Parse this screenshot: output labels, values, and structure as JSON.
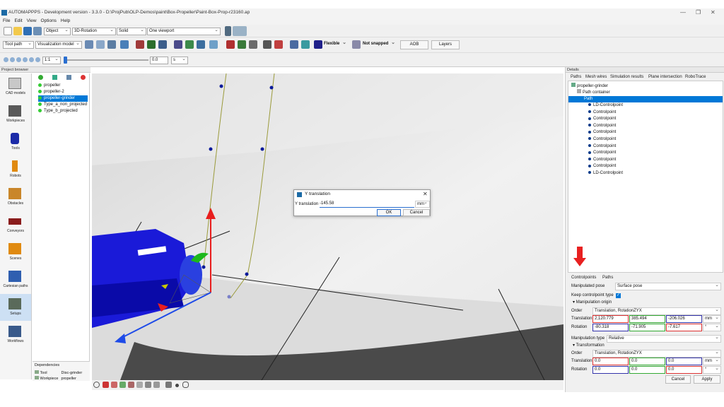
{
  "window": {
    "title": "AUTOMAPPPS - Development version - 3.3.0 - D:\\ProjPub\\OLP-Demos\\paint\\Box-Propeller\\Paint-Box-Prop-r23160.ap"
  },
  "menu": [
    "File",
    "Edit",
    "View",
    "Options",
    "Help"
  ],
  "toolbar": {
    "object_select": "Object",
    "rotation_select": "3D-Rotation",
    "shading_select": "Solid",
    "viewport_select": "One viewport",
    "toolpath_select": "Tool path",
    "visualization_select": "Visualization model",
    "flexible_label": "Flexible",
    "snap_label": "Not snapped",
    "aob_label": "AOB",
    "layers_label": "Layers",
    "speed_select": "1:1",
    "time_value": "0.0",
    "time_unit": "s"
  },
  "project_browser": {
    "title": "Project browser",
    "sidebar": [
      "CAD models",
      "Workpieces",
      "Tools",
      "Robots",
      "Obstacles",
      "Conveyors",
      "Scenes",
      "Cartesian paths",
      "Setups",
      "Workflows"
    ],
    "tree": [
      "propeller",
      "propeller-2",
      "propeller-grinder",
      "Type_a_non_projected",
      "Type_b_projected"
    ],
    "selected": "propeller-grinder"
  },
  "dependencies": {
    "title": "Dependencies",
    "rows": [
      {
        "key": "Tool",
        "value": "Disc-grinder"
      },
      {
        "key": "Workpiece",
        "value": "propeller"
      }
    ]
  },
  "dialog": {
    "title": "Y translation",
    "label": "Y translation",
    "value": "-145.58",
    "unit": "mm",
    "ok": "OK",
    "cancel": "Cancel"
  },
  "details": {
    "title": "Details",
    "tabs": [
      "Paths",
      "Mesh wires",
      "Simulation results",
      "Plane intersection",
      "RoboTrace"
    ],
    "tree": {
      "root": "propeller-grinder",
      "container": "Path container",
      "path": "Path",
      "items": [
        "LD-Controlpoint",
        "Controlpoint",
        "Controlpoint",
        "Controlpoint",
        "Controlpoint",
        "Controlpoint",
        "Controlpoint",
        "Controlpoint",
        "Controlpoint",
        "Controlpoint",
        "LD-Controlpoint"
      ]
    },
    "lower_tabs": [
      "Controlpoints",
      "Paths"
    ],
    "manipulated_pose_label": "Manipulated pose",
    "manipulated_pose": "Surface pose",
    "keep_type_label": "Keep controlpoint type",
    "origin": {
      "header": "Manipulation origin",
      "order_label": "Order",
      "order": "Translation, RotationZYX",
      "translation_label": "Translation",
      "translation": [
        "2,120.779",
        "385.494",
        "-206.026"
      ],
      "translation_unit": "mm",
      "rotation_label": "Rotation",
      "rotation": [
        "-80.318",
        "-71.905",
        "-7.617"
      ],
      "rotation_unit": "°"
    },
    "manip_type_label": "Manipulation type",
    "manip_type": "Relative",
    "transformation": {
      "header": "Transformation",
      "order_label": "Order",
      "order": "Translation, RotationZYX",
      "translation_label": "Translation",
      "translation": [
        "0.0",
        "0.0",
        "0.0"
      ],
      "translation_unit": "mm",
      "rotation_label": "Rotation",
      "rotation": [
        "0.0",
        "0.0",
        "0.0"
      ],
      "rotation_unit": "°"
    },
    "cancel": "Cancel",
    "apply": "Apply"
  },
  "colors": {
    "selection": "#0078d7",
    "axis_red": "#e81e1e",
    "axis_green": "#1cb81c",
    "axis_blue": "#1e4be8",
    "path_olive": "#9a9a3a"
  }
}
